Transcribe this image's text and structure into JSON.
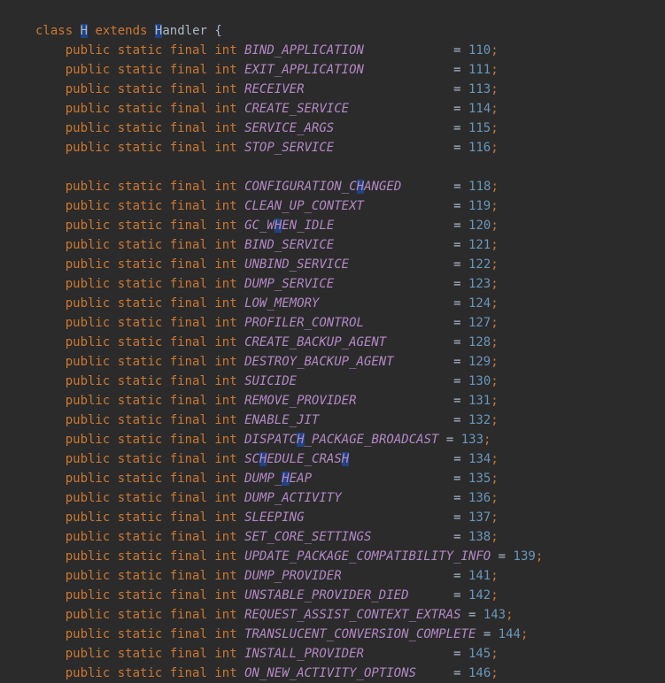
{
  "class_decl": {
    "class_kw": "class",
    "class_name_pre": "",
    "class_name_hl": "H",
    "class_name_post": "",
    "extends_kw": "extends",
    "parent_pre": "",
    "parent_hl": "H",
    "parent_post": "andler",
    "brace": "{"
  },
  "modifiers": {
    "public": "public",
    "static": "static",
    "final": "final",
    "int": "int"
  },
  "fields": [
    {
      "name": "BIND_APPLICATION",
      "pad": "            ",
      "eqpad": "",
      "val": "110"
    },
    {
      "name": "EXIT_APPLICATION",
      "pad": "            ",
      "eqpad": "",
      "val": "111"
    },
    {
      "name": "RECEIVER",
      "pad": "                    ",
      "eqpad": "",
      "val": "113"
    },
    {
      "name": "CREATE_SERVICE",
      "pad": "              ",
      "eqpad": "",
      "val": "114"
    },
    {
      "name": "SERVICE_ARGS",
      "pad": "                ",
      "eqpad": "",
      "val": "115"
    },
    {
      "name": "STOP_SERVICE",
      "pad": "                ",
      "eqpad": "",
      "val": "116"
    },
    {
      "blank": true
    },
    {
      "name": "CONFIGURATION_CHANGED",
      "pad": "       ",
      "eqpad": "",
      "val": "118",
      "hl_at": 15
    },
    {
      "name": "CLEAN_UP_CONTEXT",
      "pad": "            ",
      "eqpad": "",
      "val": "119"
    },
    {
      "name": "GC_WHEN_IDLE",
      "pad": "                ",
      "eqpad": "",
      "val": "120",
      "hl_at": 4
    },
    {
      "name": "BIND_SERVICE",
      "pad": "                ",
      "eqpad": "",
      "val": "121"
    },
    {
      "name": "UNBIND_SERVICE",
      "pad": "              ",
      "eqpad": "",
      "val": "122"
    },
    {
      "name": "DUMP_SERVICE",
      "pad": "                ",
      "eqpad": "",
      "val": "123"
    },
    {
      "name": "LOW_MEMORY",
      "pad": "                  ",
      "eqpad": "",
      "val": "124"
    },
    {
      "name": "PROFILER_CONTROL",
      "pad": "            ",
      "eqpad": "",
      "val": "127"
    },
    {
      "name": "CREATE_BACKUP_AGENT",
      "pad": "         ",
      "eqpad": "",
      "val": "128"
    },
    {
      "name": "DESTROY_BACKUP_AGENT",
      "pad": "        ",
      "eqpad": "",
      "val": "129"
    },
    {
      "name": "SUICIDE",
      "pad": "                     ",
      "eqpad": "",
      "val": "130"
    },
    {
      "name": "REMOVE_PROVIDER",
      "pad": "             ",
      "eqpad": "",
      "val": "131"
    },
    {
      "name": "ENABLE_JIT",
      "pad": "                  ",
      "eqpad": "",
      "val": "132"
    },
    {
      "name": "DISPATCH_PACKAGE_BROADCAST",
      "pad": " ",
      "eqpad": "",
      "val": "133",
      "hl_at": 7
    },
    {
      "name": "SCHEDULE_CRASH",
      "pad": "              ",
      "eqpad": "",
      "val": "134",
      "hl_at": 2,
      "hl2_at": 13
    },
    {
      "name": "DUMP_HEAP",
      "pad": "                   ",
      "eqpad": "",
      "val": "135",
      "hl_at": 5
    },
    {
      "name": "DUMP_ACTIVITY",
      "pad": "               ",
      "eqpad": "",
      "val": "136"
    },
    {
      "name": "SLEEPING",
      "pad": "                    ",
      "eqpad": "",
      "val": "137"
    },
    {
      "name": "SET_CORE_SETTINGS",
      "pad": "           ",
      "eqpad": "",
      "val": "138"
    },
    {
      "name": "UPDATE_PACKAGE_COMPATIBILITY_INFO",
      "pad": " ",
      "eqpad": "",
      "val": "139",
      "noalign": true
    },
    {
      "name": "DUMP_PROVIDER",
      "pad": "               ",
      "eqpad": "",
      "val": "141"
    },
    {
      "name": "UNSTABLE_PROVIDER_DIED",
      "pad": "      ",
      "eqpad": "",
      "val": "142"
    },
    {
      "name": "REQUEST_ASSIST_CONTEXT_EXTRAS",
      "pad": " ",
      "eqpad": "",
      "val": "143",
      "noalign": true
    },
    {
      "name": "TRANSLUCENT_CONVERSION_COMPLETE",
      "pad": " ",
      "eqpad": "",
      "val": "144",
      "noalign": true
    },
    {
      "name": "INSTALL_PROVIDER",
      "pad": "            ",
      "eqpad": "",
      "val": "145"
    },
    {
      "name": "ON_NEW_ACTIVITY_OPTIONS",
      "pad": "     ",
      "eqpad": "",
      "val": "146"
    }
  ]
}
